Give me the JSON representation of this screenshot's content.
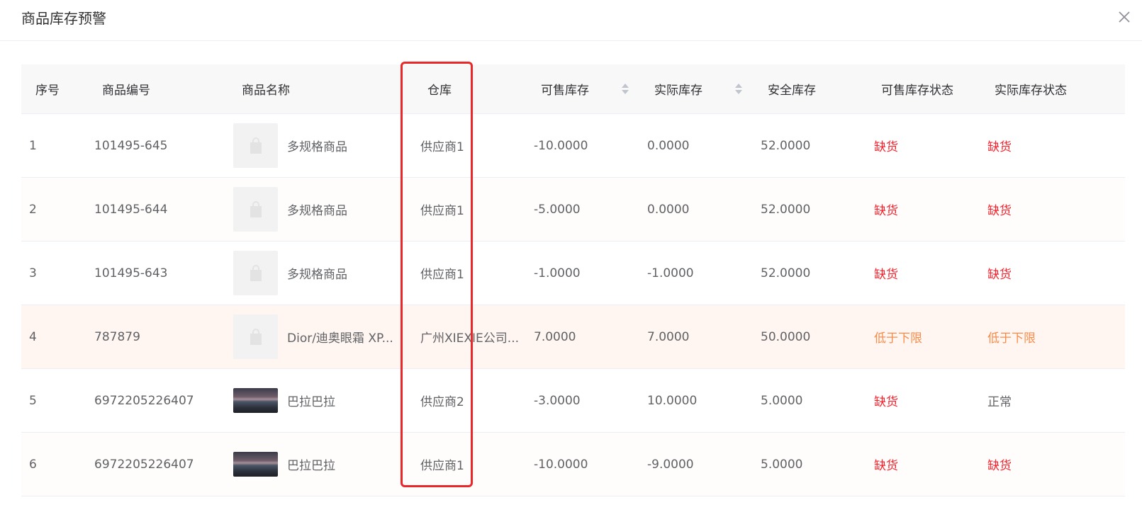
{
  "dialog": {
    "title": "商品库存预警",
    "close_icon": "close-icon"
  },
  "table": {
    "headers": [
      "序号",
      "商品编号",
      "商品名称",
      "仓库",
      "可售库存",
      "实际库存",
      "安全库存",
      "可售库存状态",
      "实际库存状态"
    ],
    "rows": [
      {
        "index": "1",
        "code": "101495-645",
        "image": "placeholder-bag-icon",
        "name": "多规格商品",
        "warehouse": "供应商1",
        "sellable": "-10.0000",
        "actual": "0.0000",
        "safety": "52.0000",
        "sellable_status": "缺货",
        "actual_status": "缺货"
      },
      {
        "index": "2",
        "code": "101495-644",
        "image": "placeholder-bag-icon",
        "name": "多规格商品",
        "warehouse": "供应商1",
        "sellable": "-5.0000",
        "actual": "0.0000",
        "safety": "52.0000",
        "sellable_status": "缺货",
        "actual_status": "缺货"
      },
      {
        "index": "3",
        "code": "101495-643",
        "image": "placeholder-bag-icon",
        "name": "多规格商品",
        "warehouse": "供应商1",
        "sellable": "-1.0000",
        "actual": "-1.0000",
        "safety": "52.0000",
        "sellable_status": "缺货",
        "actual_status": "缺货"
      },
      {
        "index": "4",
        "code": "787879",
        "image": "placeholder-bag-icon",
        "name": "Dior/迪奥眼霜 XP...",
        "warehouse": "广州XIEXIE公司...",
        "sellable": "7.0000",
        "actual": "7.0000",
        "safety": "50.0000",
        "sellable_status": "低于下限",
        "actual_status": "低于下限"
      },
      {
        "index": "5",
        "code": "6972205226407",
        "image": "landscape-photo",
        "name": "巴拉巴拉",
        "warehouse": "供应商2",
        "sellable": "-3.0000",
        "actual": "10.0000",
        "safety": "5.0000",
        "sellable_status": "缺货",
        "actual_status": "正常"
      },
      {
        "index": "6",
        "code": "6972205226407",
        "image": "landscape-photo",
        "name": "巴拉巴拉",
        "warehouse": "供应商1",
        "sellable": "-10.0000",
        "actual": "-9.0000",
        "safety": "5.0000",
        "sellable_status": "缺货",
        "actual_status": "缺货"
      }
    ]
  },
  "colors": {
    "status_out_of_stock": "#f5222d",
    "status_below_limit": "#fa8c4a",
    "highlight_box": "#e8282b",
    "warn_row_bg": "#fff5f1"
  }
}
